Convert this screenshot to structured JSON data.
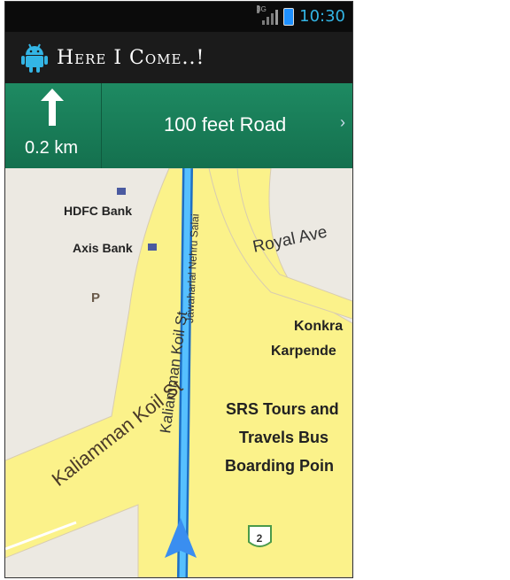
{
  "status_bar": {
    "network": "3G",
    "time": "10:30"
  },
  "action_bar": {
    "app_title": "Here I Come..!",
    "app_icon": "android-icon"
  },
  "navigation": {
    "maneuver_icon": "arrow-up-icon",
    "distance": "0.2 km",
    "road_name": "100 feet Road",
    "next_icon": "chevron-right-icon"
  },
  "map": {
    "streets": {
      "main_road": "Jawaharlal Nehru Salai",
      "side_street": "Kaliamman Koil St",
      "right_street": "Royal Ave"
    },
    "places": {
      "hdfc": "HDFC Bank",
      "axis": "Axis Bank",
      "parking": "P",
      "konkra_line1": "Konkra",
      "konkra_line2": "Karpende",
      "srs_line1": "SRS Tours and",
      "srs_line2": "Travels Bus",
      "srs_line3": "Boarding Poin"
    },
    "route_shield": "2",
    "colors": {
      "road": "#fbf28a",
      "route": "#3da7f0",
      "land": "#ece9e2",
      "banner": "#1b7f5a"
    }
  }
}
